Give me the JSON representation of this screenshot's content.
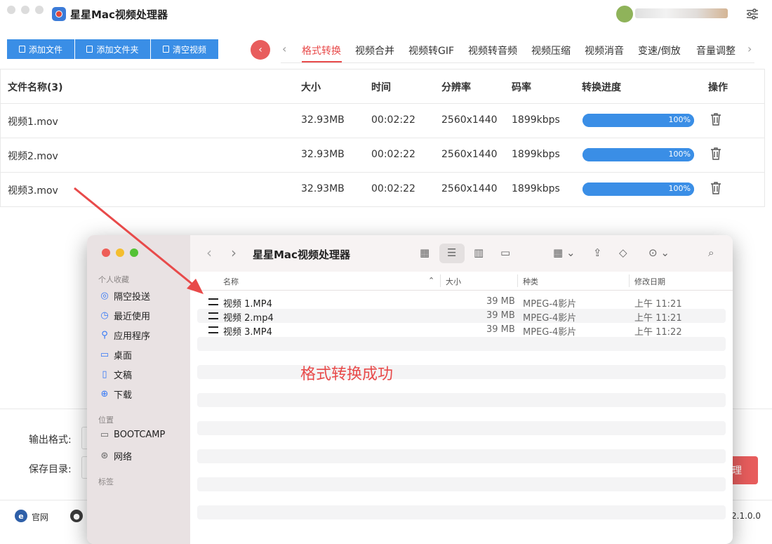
{
  "app": {
    "title": "星星Mac视频处理器",
    "version": "2.1.0.0"
  },
  "toolbar": {
    "add_file": "添加文件",
    "add_folder": "添加文件夹",
    "clear": "清空视频",
    "collapse_icon": "chevron-left-icon"
  },
  "tabs": [
    {
      "label": "格式转换",
      "active": true
    },
    {
      "label": "视频合并"
    },
    {
      "label": "视频转GIF"
    },
    {
      "label": "视频转音频"
    },
    {
      "label": "视频压缩"
    },
    {
      "label": "视频消音"
    },
    {
      "label": "变速/倒放"
    },
    {
      "label": "音量调整"
    }
  ],
  "table": {
    "headers": {
      "name": "文件名称(3)",
      "size": "大小",
      "time": "时间",
      "resolution": "分辨率",
      "bitrate": "码率",
      "progress": "转换进度",
      "action": "操作"
    },
    "rows": [
      {
        "name": "视频1.mov",
        "size": "32.93MB",
        "time": "00:02:22",
        "resolution": "2560x1440",
        "bitrate": "1899kbps",
        "progress": 100,
        "progress_text": "100%"
      },
      {
        "name": "视频2.mov",
        "size": "32.93MB",
        "time": "00:02:22",
        "resolution": "2560x1440",
        "bitrate": "1899kbps",
        "progress": 100,
        "progress_text": "100%"
      },
      {
        "name": "视频3.mov",
        "size": "32.93MB",
        "time": "00:02:22",
        "resolution": "2560x1440",
        "bitrate": "1899kbps",
        "progress": 100,
        "progress_text": "100%"
      }
    ]
  },
  "bottom": {
    "output_format_label": "输出格式:",
    "save_dir_label": "保存目录:",
    "start_partial": "理"
  },
  "footer": {
    "website": "官网"
  },
  "finder": {
    "title": "星星Mac视频处理器",
    "sidebar": {
      "favorites_header": "个人收藏",
      "favorites": [
        {
          "label": "隔空投送",
          "icon": "airdrop-icon"
        },
        {
          "label": "最近使用",
          "icon": "clock-icon"
        },
        {
          "label": "应用程序",
          "icon": "apps-icon"
        },
        {
          "label": "桌面",
          "icon": "desktop-icon"
        },
        {
          "label": "文稿",
          "icon": "document-icon"
        },
        {
          "label": "下载",
          "icon": "download-icon"
        }
      ],
      "locations_header": "位置",
      "locations": [
        {
          "label": "BOOTCAMP",
          "icon": "drive-icon"
        },
        {
          "label": "网络",
          "icon": "network-icon"
        }
      ],
      "tags_header": "标签"
    },
    "columns": {
      "name": "名称",
      "size": "大小",
      "kind": "种类",
      "modified": "修改日期"
    },
    "files": [
      {
        "name": "视频 1.MP4",
        "size": "39 MB",
        "kind": "MPEG-4影片",
        "modified": "上午 11:21"
      },
      {
        "name": "视频 2.mp4",
        "size": "39 MB",
        "kind": "MPEG-4影片",
        "modified": "上午 11:21"
      },
      {
        "name": "视频 3.MP4",
        "size": "39 MB",
        "kind": "MPEG-4影片",
        "modified": "上午 11:22"
      }
    ]
  },
  "annotation": {
    "text": "格式转换成功",
    "color": "#e84a4a"
  },
  "colors": {
    "accent_blue": "#3a8ee6",
    "accent_red": "#e85d5d"
  }
}
